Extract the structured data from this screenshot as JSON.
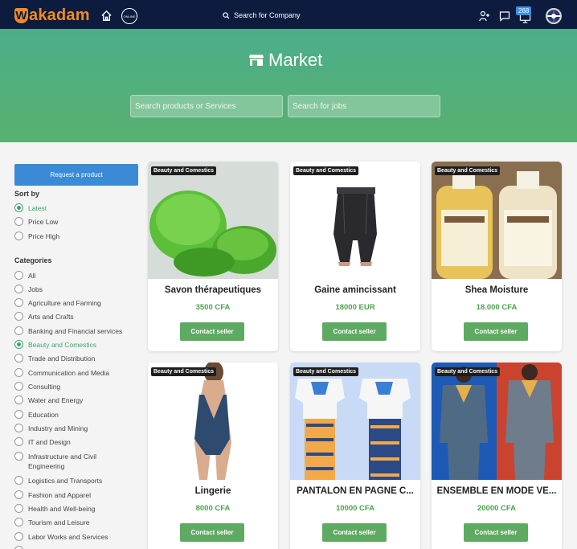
{
  "header": {
    "logo_text": "akadam",
    "logo_mark": "W",
    "online_label": "ONLINE",
    "search_placeholder": "Search for Company",
    "notification_count": "268"
  },
  "hero": {
    "title": "Market",
    "search_products_placeholder": "Search products or Services",
    "search_jobs_placeholder": "Search for jobs"
  },
  "sidebar": {
    "request_button": "Request a product",
    "sort_label": "Sort by",
    "sort_options": [
      {
        "label": "Latest",
        "selected": true
      },
      {
        "label": "Price Low",
        "selected": false
      },
      {
        "label": "Price High",
        "selected": false
      }
    ],
    "categories_label": "Categories",
    "categories": [
      {
        "label": "All",
        "selected": false
      },
      {
        "label": "Jobs",
        "selected": false
      },
      {
        "label": "Agriculture and Farming",
        "selected": false
      },
      {
        "label": "Arts and Crafts",
        "selected": false
      },
      {
        "label": "Banking and Financial services",
        "selected": false
      },
      {
        "label": "Beauty and Comestics",
        "selected": true
      },
      {
        "label": "Trade and Distribution",
        "selected": false
      },
      {
        "label": "Communication and Media",
        "selected": false
      },
      {
        "label": "Consulting",
        "selected": false
      },
      {
        "label": "Water and Energy",
        "selected": false
      },
      {
        "label": "Education",
        "selected": false
      },
      {
        "label": "Industry and Mining",
        "selected": false
      },
      {
        "label": "IT and Design",
        "selected": false
      },
      {
        "label": "Infrastructure and Civil Engineering",
        "selected": false
      },
      {
        "label": "Logistics and Transports",
        "selected": false
      },
      {
        "label": "Fashion and Apparel",
        "selected": false
      },
      {
        "label": "Health and Well-being",
        "selected": false
      },
      {
        "label": "Tourism and Leisure",
        "selected": false
      },
      {
        "label": "Labor Works and Services",
        "selected": false
      }
    ]
  },
  "products": [
    {
      "tag": "Beauty and Comestics",
      "title": "Savon thérapeutiques",
      "price": "3500 CFA",
      "button": "Contact seller"
    },
    {
      "tag": "Beauty and Comestics",
      "title": "Gaine amincissant",
      "price": "18000 EUR",
      "button": "Contact seller"
    },
    {
      "tag": "Beauty and Comestics",
      "title": "Shea Moisture",
      "price": "18.000 CFA",
      "button": "Contact seller"
    },
    {
      "tag": "Beauty and Comestics",
      "title": "Lingerie",
      "price": "8000 CFA",
      "button": "Contact seller"
    },
    {
      "tag": "Beauty and Comestics",
      "title": "PANTALON EN PAGNE C...",
      "price": "10000 CFA",
      "button": "Contact seller"
    },
    {
      "tag": "Beauty and Comestics",
      "title": "ENSEMBLE EN MODE VE...",
      "price": "20000 CFA",
      "button": "Contact seller"
    }
  ],
  "colors": {
    "nav_bg": "#0d1b3e",
    "brand_orange": "#f08a24",
    "hero_green": "#58b16f",
    "accent_blue": "#3a8ad6",
    "seller_button": "#5faa62",
    "price_green": "#4ba24f"
  }
}
